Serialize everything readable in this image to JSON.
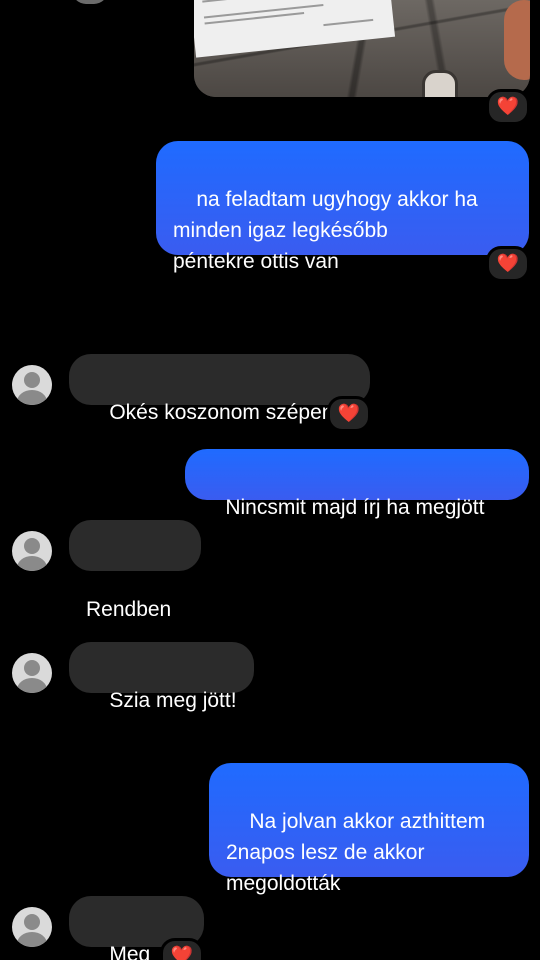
{
  "conversation": {
    "messages": [
      {
        "id": "m1",
        "from": "me",
        "text": "na feladtam ugyhogy akkor ha\nminden igaz legkésőbb\npéntekre ottis van",
        "reaction": "❤️"
      },
      {
        "id": "m2",
        "from": "them",
        "text": "Okés koszonom szépen!",
        "reaction": "❤️"
      },
      {
        "id": "m3",
        "from": "me",
        "text": "Nincsmit majd írj ha megjött"
      },
      {
        "id": "m4",
        "from": "them",
        "text": "Rendben"
      },
      {
        "id": "m5",
        "from": "them",
        "text": "Szia meg jött!"
      },
      {
        "id": "m6",
        "from": "me",
        "text": "Na jolvan akkor azthittem\n2napos lesz de akkor\nmegoldották"
      },
      {
        "id": "m7",
        "from": "them",
        "text": "Meg igen",
        "reaction": "❤️"
      }
    ],
    "photo_reaction": "❤️",
    "photo_doc_text": [
      "Vállalkozás",
      "Magyar Posta Zrt."
    ]
  },
  "colors": {
    "background": "#000000",
    "outgoing_bubble": "#2f6af6",
    "incoming_bubble": "#2b2b2b",
    "reaction_bg": "#262626",
    "heart": "#ff2d3b"
  },
  "icons": {
    "avatar": "default-user-avatar",
    "reaction": "red-heart"
  }
}
